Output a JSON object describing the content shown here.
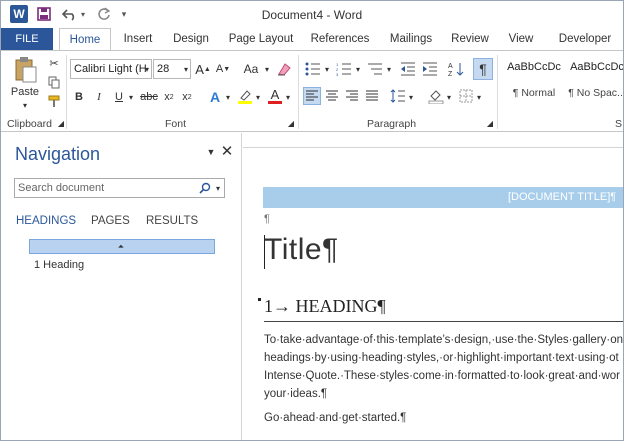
{
  "titlebar": {
    "app_logo": "W",
    "document_title": "Document4 - Word",
    "icons": [
      "word-logo-icon",
      "save-icon",
      "undo-icon",
      "redo-icon",
      "customize-qat-icon"
    ]
  },
  "tabs": {
    "file": "FILE",
    "items": [
      "Home",
      "Insert",
      "Design",
      "Page Layout",
      "References",
      "Mailings",
      "Review",
      "View",
      "Developer"
    ]
  },
  "ribbon": {
    "clipboard": {
      "paste": "Paste",
      "label": "Clipboard"
    },
    "font": {
      "font_name": "Calibri Light (H",
      "font_size": "28",
      "grow": "A",
      "shrink": "A",
      "change_case": "Aa",
      "bold": "B",
      "italic": "I",
      "underline": "U",
      "strike": "abc",
      "subscript": "x",
      "superscript": "x",
      "label": "Font"
    },
    "paragraph": {
      "label": "Paragraph",
      "pilcrow": "¶"
    },
    "styles": [
      {
        "preview": "AaBbCcDc",
        "name": "¶ Normal"
      },
      {
        "preview": "AaBbCcDc",
        "name": "¶ No Spac..."
      }
    ],
    "styles_label_partial": "S"
  },
  "navigation": {
    "title": "Navigation",
    "search_placeholder": "Search document",
    "tabs": [
      "HEADINGS",
      "PAGES",
      "RESULTS"
    ],
    "headings": [
      "1 Heading"
    ]
  },
  "document": {
    "document_title_field": "[DOCUMENT TITLE]¶",
    "pilcrow": "¶",
    "title": "Title¶",
    "heading_number": "1→",
    "heading": "HEADING¶",
    "body_lines": [
      "To·take·advantage·of·this·template’s·design,·use·the·Styles·gallery·on",
      "headings·by·using·heading·styles,·or·highlight·important·text·using·ot",
      "Intense·Quote.·These·styles·come·in·formatted·to·look·great·and·wor",
      "your·ideas.¶"
    ],
    "closing": "Go·ahead·and·get·started.¶"
  },
  "colors": {
    "accent": "#2b579a",
    "doc_title_band": "#a7cdea",
    "heading_bar": "#b8d2f0",
    "highlight": "#ffff00",
    "font_color": "#e02020"
  }
}
